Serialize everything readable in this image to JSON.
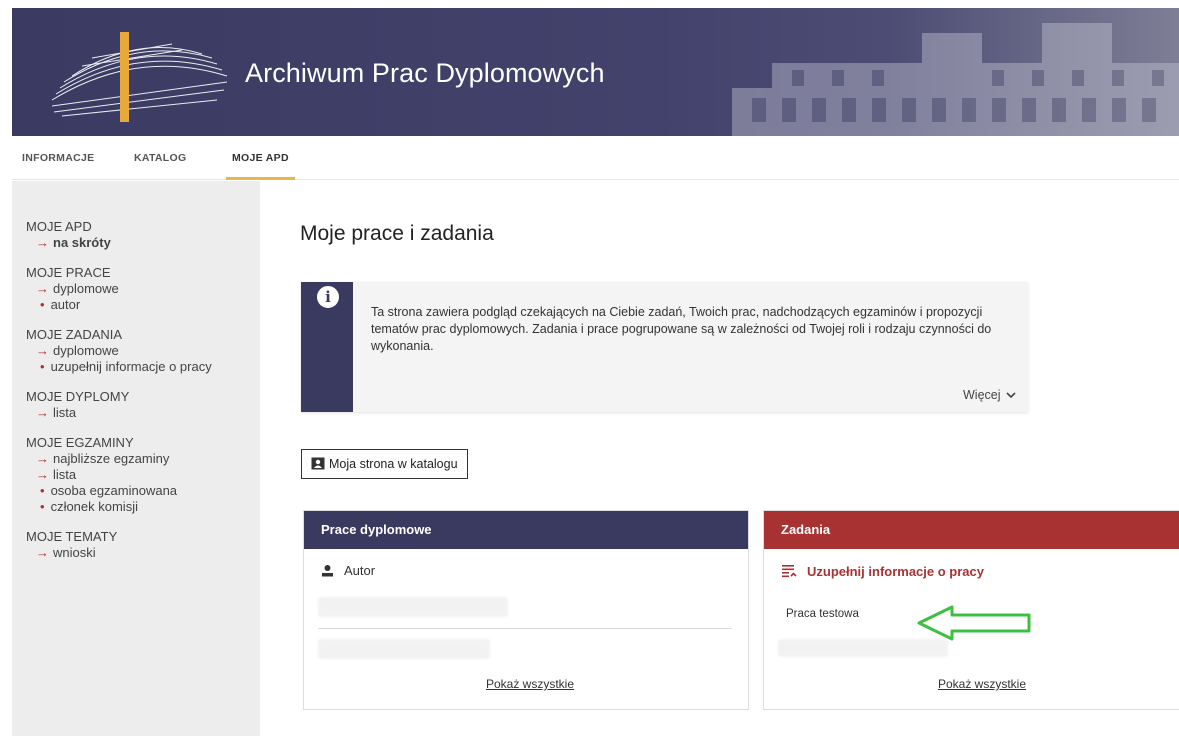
{
  "header": {
    "title": "Archiwum Prac Dyplomowych",
    "logo_icon": "apd-logo-icon"
  },
  "topnav": {
    "tabs": [
      {
        "label": "INFORMACJE"
      },
      {
        "label": "KATALOG"
      },
      {
        "label": "MOJE APD",
        "active": true
      }
    ],
    "accent": "#e6b84a"
  },
  "sidebar": {
    "g1": {
      "head": "MOJE APD",
      "links": [
        "na skróty"
      ]
    },
    "g2": {
      "head": "MOJE PRACE",
      "links": [
        "dyplomowe"
      ],
      "subs": [
        "autor"
      ]
    },
    "g3": {
      "head": "MOJE ZADANIA",
      "links": [
        "dyplomowe"
      ],
      "subs": [
        "uzupełnij informacje o pracy"
      ]
    },
    "g4": {
      "head": "MOJE DYPLOMY",
      "links": [
        "lista"
      ]
    },
    "g5": {
      "head": "MOJE EGZAMINY",
      "links": [
        "najbliższe egzaminy",
        "lista"
      ],
      "subs": [
        "osoba egzaminowana",
        "członek komisji"
      ]
    },
    "g6": {
      "head": "MOJE TEMATY",
      "links": [
        "wnioski"
      ]
    }
  },
  "main": {
    "title": "Moje prace i zadania",
    "info": {
      "text": "Ta strona zawiera podgląd czekających na Ciebie zadań, Twoich prac, nadchodzących egzaminów i propozycji tematów prac dyplomowych. Zadania i prace pogrupowane są w zależności od Twojej roli i rodzaju czynności do wykonania.",
      "more_label": "Więcej"
    },
    "catalog_button": "Moja strona w katalogu",
    "works_card": {
      "title": "Prace dyplomowe",
      "role": "Autor",
      "show_all": "Pokaż wszystkie",
      "color": "#3a3a60"
    },
    "tasks_card": {
      "title": "Zadania",
      "task": "Uzupełnij informacje o pracy",
      "work": "Praca testowa",
      "show_all": "Pokaż wszystkie",
      "color": "#a83232",
      "annotation_color": "#3fbf3f"
    }
  }
}
